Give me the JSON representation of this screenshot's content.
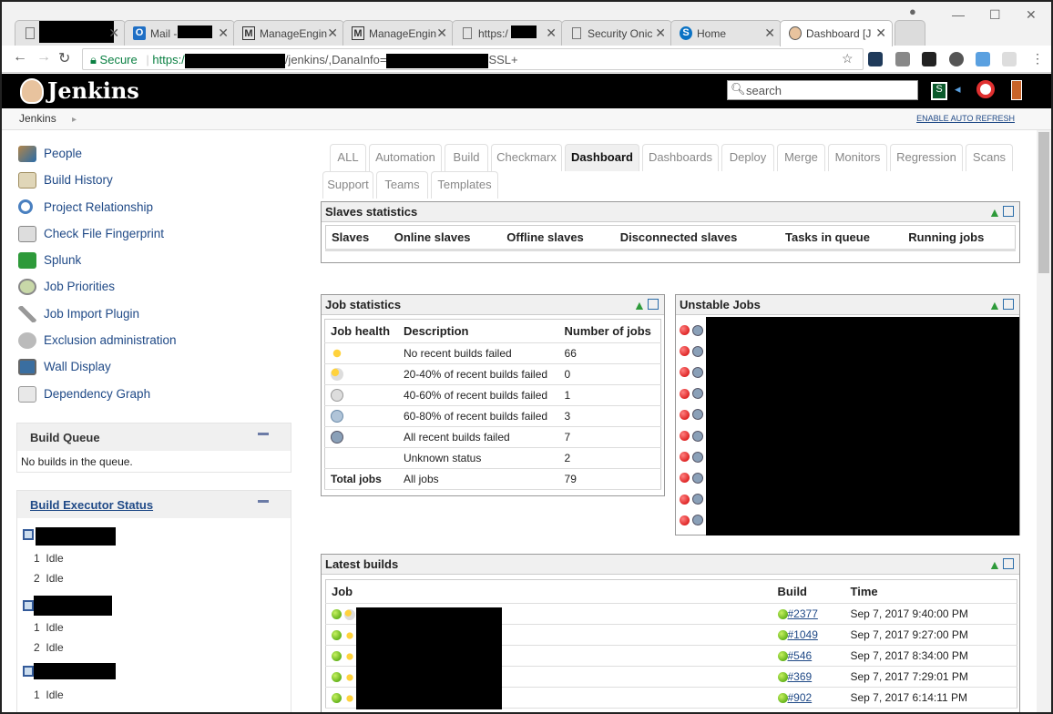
{
  "browser": {
    "tabs": [
      {
        "label": "",
        "icon": "document-icon"
      },
      {
        "label": "Mail -",
        "icon": "outlook-icon"
      },
      {
        "label": "ManageEngin",
        "icon": "manageengine-icon"
      },
      {
        "label": "ManageEngin",
        "icon": "manageengine-icon"
      },
      {
        "label": "https:/",
        "icon": "document-icon"
      },
      {
        "label": "Security Onic",
        "icon": "document-icon"
      },
      {
        "label": "Home",
        "icon": "sharepoint-icon"
      },
      {
        "label": "Dashboard [J",
        "icon": "jenkins-icon"
      }
    ],
    "secure_label": "Secure",
    "url_start": "https:/",
    "url_mid": "/jenkins/,DanaInfo=",
    "url_end": "SSL+"
  },
  "header": {
    "title": "Jenkins",
    "search_placeholder": "search"
  },
  "breadcrumb": {
    "root": "Jenkins",
    "auto_refresh": "ENABLE AUTO REFRESH"
  },
  "sidebar": {
    "items": [
      {
        "label": "People",
        "icon": "people-icon"
      },
      {
        "label": "Build History",
        "icon": "notepad-icon"
      },
      {
        "label": "Project Relationship",
        "icon": "magnifier-icon"
      },
      {
        "label": "Check File Fingerprint",
        "icon": "fingerprint-icon"
      },
      {
        "label": "Splunk",
        "icon": "splunk-icon"
      },
      {
        "label": "Job Priorities",
        "icon": "priority-icon"
      },
      {
        "label": "Job Import Plugin",
        "icon": "tools-icon"
      },
      {
        "label": "Exclusion administration",
        "icon": "gears-icon"
      },
      {
        "label": "Wall Display",
        "icon": "monitor-icon"
      },
      {
        "label": "Dependency Graph",
        "icon": "graph-icon"
      }
    ],
    "build_queue": {
      "title": "Build Queue",
      "empty": "No builds in the queue."
    },
    "executors": {
      "title": "Build Executor Status",
      "nodes": [
        {
          "slots": [
            {
              "num": "1",
              "status": "Idle"
            },
            {
              "num": "2",
              "status": "Idle"
            }
          ]
        },
        {
          "slots": [
            {
              "num": "1",
              "status": "Idle"
            },
            {
              "num": "2",
              "status": "Idle"
            }
          ]
        },
        {
          "slots": [
            {
              "num": "1",
              "status": "Idle"
            }
          ]
        }
      ]
    }
  },
  "view_tabs": [
    "ALL",
    "Automation",
    "Build",
    "Checkmarx",
    "Dashboard",
    "Dashboards",
    "Deploy",
    "Merge",
    "Monitors",
    "Regression",
    "Scans",
    "Support",
    "Teams",
    "Templates"
  ],
  "active_view": "Dashboard",
  "slaves": {
    "title": "Slaves statistics",
    "columns": [
      "Slaves",
      "Online slaves",
      "Offline slaves",
      "Disconnected slaves",
      "Tasks in queue",
      "Running jobs"
    ]
  },
  "job_stats": {
    "title": "Job statistics",
    "columns": [
      "Job health",
      "Description",
      "Number of jobs"
    ],
    "rows": [
      {
        "icon": "sunny-icon",
        "desc": "No recent builds failed",
        "count": "66"
      },
      {
        "icon": "partly-sunny-icon",
        "desc": "20-40% of recent builds failed",
        "count": "0"
      },
      {
        "icon": "cloudy-icon",
        "desc": "40-60% of recent builds failed",
        "count": "1"
      },
      {
        "icon": "rain-icon",
        "desc": "60-80% of recent builds failed",
        "count": "3"
      },
      {
        "icon": "thunderstorm-icon",
        "desc": "All recent builds failed",
        "count": "7"
      },
      {
        "icon": "",
        "desc": "Unknown status",
        "count": "2"
      }
    ],
    "total": {
      "label": "Total jobs",
      "desc": "All jobs",
      "count": "79"
    }
  },
  "unstable_jobs": {
    "title": "Unstable Jobs",
    "count_rows": 10
  },
  "latest_builds": {
    "title": "Latest builds",
    "columns": [
      "Job",
      "Build",
      "Time"
    ],
    "rows": [
      {
        "weather": "partly-sunny-icon",
        "build": "#2377",
        "time": "Sep 7, 2017 9:40:00 PM"
      },
      {
        "weather": "sunny-icon",
        "build": "#1049",
        "time": "Sep 7, 2017 9:27:00 PM"
      },
      {
        "weather": "sunny-icon",
        "build": "#546",
        "time": "Sep 7, 2017 8:34:00 PM"
      },
      {
        "weather": "sunny-icon",
        "build": "#369",
        "time": "Sep 7, 2017 7:29:01 PM"
      },
      {
        "weather": "sunny-icon",
        "build": "#902",
        "time": "Sep 7, 2017 6:14:11 PM"
      }
    ]
  },
  "colors": {
    "link": "#204a87",
    "header_bg": "#000000",
    "panel_header": "#f0f0f0"
  }
}
